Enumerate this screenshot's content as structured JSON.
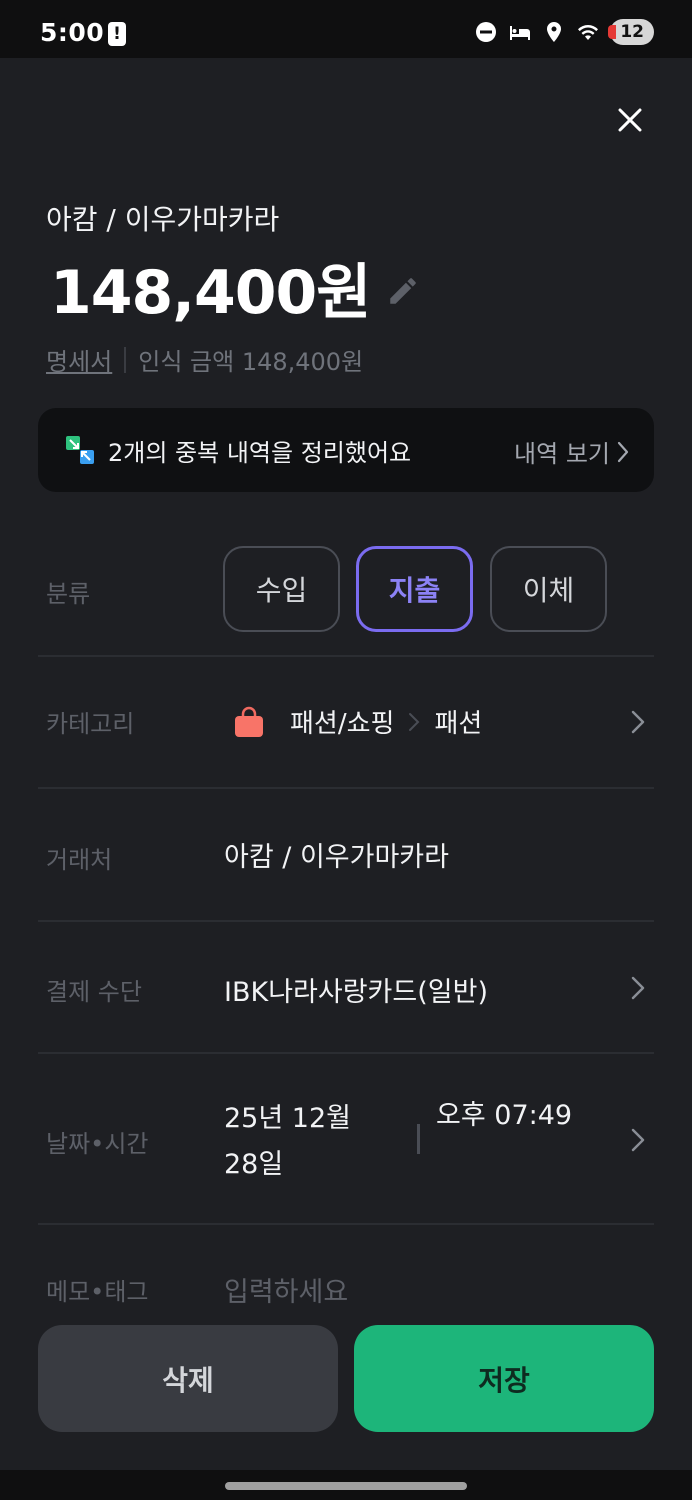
{
  "status_bar": {
    "time": "5:00",
    "alert_glyph": "!",
    "battery_level": "12",
    "icons": [
      "alert-icon",
      "do-not-disturb-icon",
      "bed-icon",
      "location-icon",
      "wifi-icon"
    ]
  },
  "header": {
    "merchant_title": "아캄 / 이우가마카라",
    "amount": "148,400원",
    "receipt_link": "명세서",
    "recognized_amount": "인식 금액 148,400원"
  },
  "banner": {
    "text": "2개의 중복 내역을 정리했어요",
    "link": "내역 보기"
  },
  "type_row": {
    "label": "분류",
    "options": [
      "수입",
      "지출",
      "이체"
    ],
    "selected": "지출"
  },
  "category_row": {
    "label": "카테고리",
    "main": "패션/쇼핑",
    "separator": ">",
    "sub": "패션"
  },
  "merchant_row": {
    "label": "거래처",
    "value": "아캄 / 이우가마카라"
  },
  "payment_row": {
    "label": "결제 수단",
    "value": "IBK나라사랑카드(일반)"
  },
  "datetime_row": {
    "label": "날짜•시간",
    "date_line1": "25년 12월",
    "date_line2": "28일",
    "time": "오후 07:49"
  },
  "memo_row": {
    "label": "메모•태그",
    "placeholder": "입력하세요"
  },
  "actions": {
    "delete": "삭제",
    "save": "저장"
  },
  "colors": {
    "background": "#1e1f23",
    "accent_purple": "#7b6cf0",
    "save_green": "#1db57a",
    "delete_gray": "#393b41"
  }
}
